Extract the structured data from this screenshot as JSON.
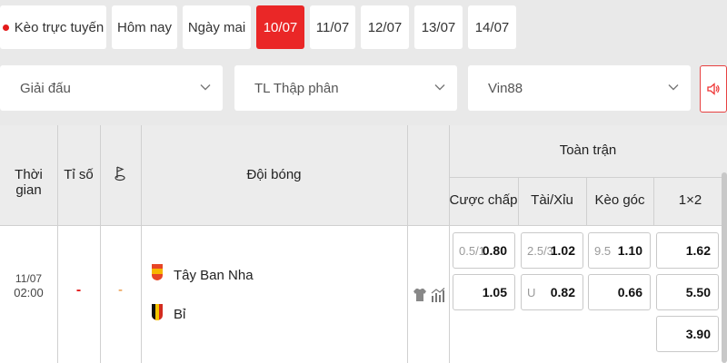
{
  "date_tabs": [
    {
      "label": "Kèo trực tuyến",
      "active": false,
      "live": true
    },
    {
      "label": "Hôm nay",
      "active": false
    },
    {
      "label": "Ngày mai",
      "active": false
    },
    {
      "label": "10/07",
      "active": true
    },
    {
      "label": "11/07",
      "active": false
    },
    {
      "label": "12/07",
      "active": false
    },
    {
      "label": "13/07",
      "active": false
    },
    {
      "label": "14/07",
      "active": false
    }
  ],
  "filters": {
    "league": "Giải đấu",
    "odds_format": "TL Thập phân",
    "bookmaker": "Vin88"
  },
  "table": {
    "headers": {
      "time": "Thời gian",
      "score": "Tỉ số",
      "teams": "Đội bóng",
      "full_match": "Toàn trận",
      "handicap": "Cược chấp",
      "over_under": "Tài/Xỉu",
      "corner": "Kèo góc",
      "one_x_two": "1×2"
    },
    "match": {
      "date": "11/07",
      "time": "02:00",
      "score": "-",
      "corner_score": "-",
      "home": "Tây Ban Nha",
      "away": "Bỉ",
      "handicap": [
        {
          "line": "0.5/1",
          "odds": "0.80"
        },
        {
          "line": "",
          "odds": "1.05"
        }
      ],
      "over_under": [
        {
          "line": "2.5/3",
          "odds": "1.02"
        },
        {
          "line": "U",
          "odds": "0.82"
        }
      ],
      "corner": [
        {
          "line": "9.5",
          "odds": "1.10"
        },
        {
          "line": "",
          "odds": "0.66"
        }
      ],
      "one_x_two": [
        "1.62",
        "5.50",
        "3.90"
      ]
    }
  },
  "colors": {
    "accent": "#ea2727",
    "header_bg": "#ececec",
    "page_bg": "#e9e9e9"
  }
}
